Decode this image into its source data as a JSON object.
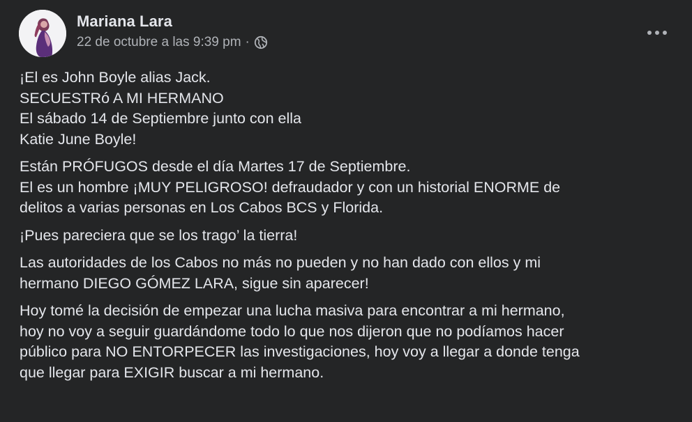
{
  "post": {
    "author": "Mariana Lara",
    "timestamp": "22 de octubre a las 9:39 pm",
    "separator": "·",
    "audience_icon": "globe-icon",
    "menu_icon": "more-options-icon",
    "paragraphs": [
      {
        "lines": [
          "¡El es John Boyle alias Jack.",
          "SECUESTRó A MI HERMANO",
          "El sábado 14 de Septiembre junto con ella",
          "Katie June Boyle!"
        ]
      },
      {
        "lines": [
          "Están PRÓFUGOS  desde el día Martes 17 de Septiembre.",
          "El es un hombre ¡MUY PELIGROSO! defraudador y con un historial  ENORME de",
          "delitos a varias personas en Los Cabos BCS y Florida."
        ]
      },
      {
        "lines": [
          "¡Pues pareciera que se los trago’ la tierra!"
        ]
      },
      {
        "lines": [
          "Las autoridades de los Cabos no más no pueden y no han dado con ellos y mi",
          "hermano DIEGO GÓMEZ LARA, sigue sin aparecer!"
        ]
      },
      {
        "lines": [
          "Hoy tomé la decisión de empezar una lucha masiva para encontrar a mi hermano,",
          "hoy no voy a seguir guardándome todo lo que nos dijeron que no podíamos hacer",
          "público para NO ENTORPECER las investigaciones,  hoy voy a llegar a donde tenga",
          "que llegar para EXIGIR buscar a mi hermano."
        ]
      }
    ]
  },
  "colors": {
    "background": "#242526",
    "primary_text": "#e4e6eb",
    "secondary_text": "#b0b3b8"
  }
}
